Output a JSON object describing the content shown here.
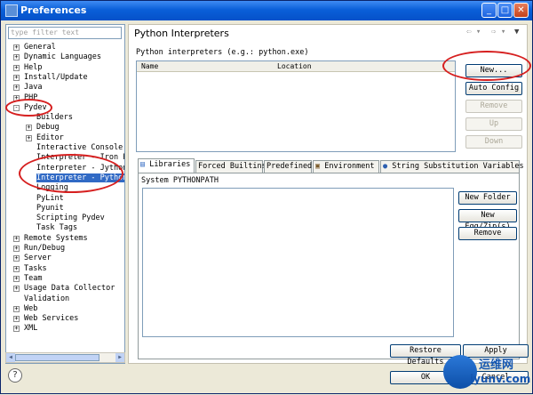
{
  "window": {
    "title": "Preferences"
  },
  "sidebar": {
    "filter_placeholder": "type filter text",
    "items": [
      {
        "label": "General",
        "exp": "+"
      },
      {
        "label": "Dynamic Languages",
        "exp": "+"
      },
      {
        "label": "Help",
        "exp": "+"
      },
      {
        "label": "Install/Update",
        "exp": "+"
      },
      {
        "label": "Java",
        "exp": "+"
      },
      {
        "label": "PHP",
        "exp": "+"
      },
      {
        "label": "Pydev",
        "exp": "−"
      },
      {
        "label": "Builders",
        "exp": ""
      },
      {
        "label": "Debug",
        "exp": "+"
      },
      {
        "label": "Editor",
        "exp": "+"
      },
      {
        "label": "Interactive Console",
        "exp": ""
      },
      {
        "label": "Interpreter - Iron Py",
        "exp": ""
      },
      {
        "label": "Interpreter - Jython",
        "exp": ""
      },
      {
        "label": "Interpreter - Python",
        "exp": ""
      },
      {
        "label": "Logging",
        "exp": ""
      },
      {
        "label": "PyLint",
        "exp": ""
      },
      {
        "label": "Pyunit",
        "exp": ""
      },
      {
        "label": "Scripting Pydev",
        "exp": ""
      },
      {
        "label": "Task Tags",
        "exp": ""
      },
      {
        "label": "Remote Systems",
        "exp": "+"
      },
      {
        "label": "Run/Debug",
        "exp": "+"
      },
      {
        "label": "Server",
        "exp": "+"
      },
      {
        "label": "Tasks",
        "exp": "+"
      },
      {
        "label": "Team",
        "exp": "+"
      },
      {
        "label": "Usage Data Collector",
        "exp": "+"
      },
      {
        "label": "Validation",
        "exp": ""
      },
      {
        "label": "Web",
        "exp": "+"
      },
      {
        "label": "Web Services",
        "exp": "+"
      },
      {
        "label": "XML",
        "exp": "+"
      }
    ]
  },
  "main": {
    "title": "Python Interpreters",
    "interpreters_label": "Python interpreters (e.g.: python.exe)",
    "col_name": "Name",
    "col_location": "Location",
    "buttons": {
      "new": "New...",
      "auto_config": "Auto Config",
      "remove": "Remove",
      "up": "Up",
      "down": "Down"
    },
    "tabs": [
      "Libraries",
      "Forced Builtins",
      "Predefined",
      "Environment",
      "String Substitution Variables"
    ],
    "system_path_label": "System PYTHONPATH",
    "lib_buttons": {
      "new_folder": "New Folder",
      "new_egg": "New Egg/Zip(s)",
      "remove": "Remove"
    },
    "restore_defaults": "Restore Defaults",
    "apply": "Apply"
  },
  "footer": {
    "ok": "OK",
    "cancel": "Cancel"
  },
  "watermark": {
    "line1": "运维网",
    "line2": "iyunv.com"
  },
  "colors": {
    "selection": "#316ac5",
    "titlebar": "#0a5fd8",
    "annotation": "#d62020"
  }
}
